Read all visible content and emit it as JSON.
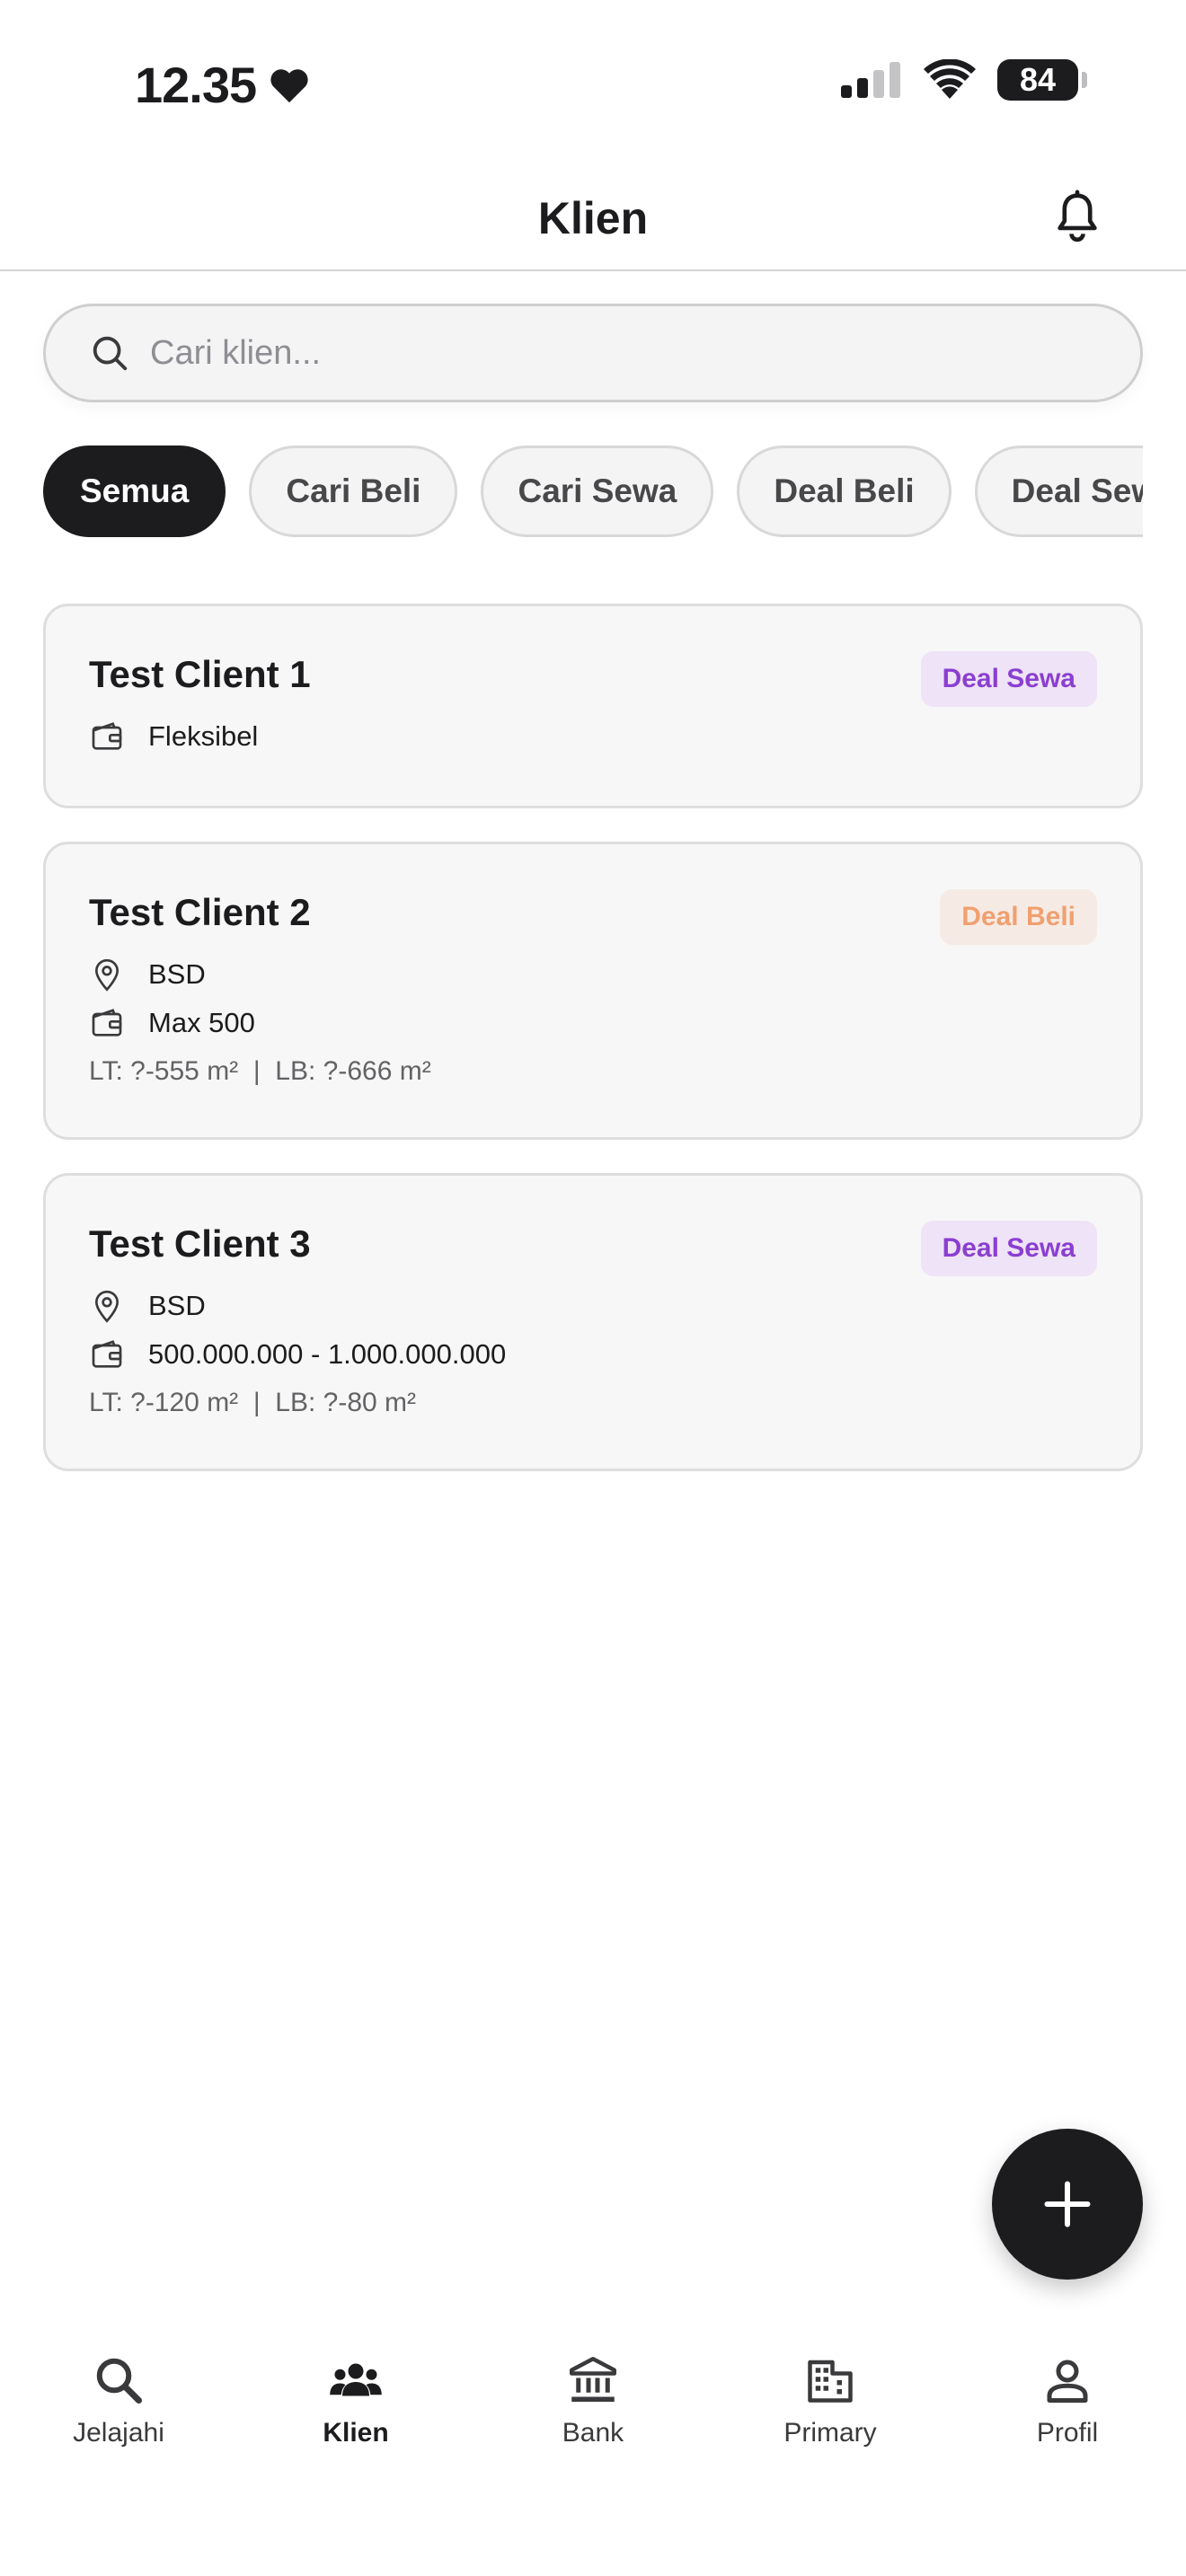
{
  "status_bar": {
    "time": "12.35",
    "battery": "84"
  },
  "header": {
    "title": "Klien"
  },
  "search": {
    "placeholder": "Cari klien..."
  },
  "filters": [
    {
      "label": "Semua",
      "active": true
    },
    {
      "label": "Cari Beli",
      "active": false
    },
    {
      "label": "Cari Sewa",
      "active": false
    },
    {
      "label": "Deal Beli",
      "active": false
    },
    {
      "label": "Deal Sewa",
      "active": false
    }
  ],
  "clients": [
    {
      "name": "Test Client 1",
      "status": "Deal Sewa",
      "budget": "Fleksibel"
    },
    {
      "name": "Test Client 2",
      "status": "Deal Beli",
      "location": "BSD",
      "budget": "Max 500",
      "size": "LT: ?-555 m²  |  LB: ?-666 m²"
    },
    {
      "name": "Test Client 3",
      "status": "Deal Sewa",
      "location": "BSD",
      "budget": "500.000.000 - 1.000.000.000",
      "size": "LT: ?-120 m²  |  LB: ?-80 m²"
    }
  ],
  "badge_colors": {
    "deal_sewa": {
      "bg": "#efe3f7",
      "fg": "#8b3fd1"
    },
    "deal_beli": {
      "bg": "#f6ebe4",
      "fg": "#f0a070"
    }
  },
  "bottom_nav": [
    {
      "label": "Jelajahi",
      "icon": "search-icon",
      "active": false
    },
    {
      "label": "Klien",
      "icon": "people-icon",
      "active": true
    },
    {
      "label": "Bank",
      "icon": "bank-icon",
      "active": false
    },
    {
      "label": "Primary",
      "icon": "building-icon",
      "active": false
    },
    {
      "label": "Profil",
      "icon": "person-icon",
      "active": false
    }
  ]
}
